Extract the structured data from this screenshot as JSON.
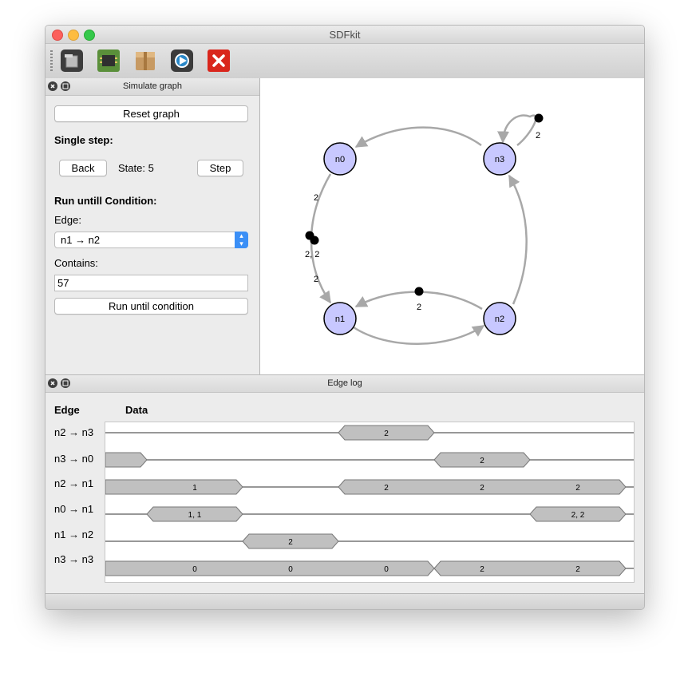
{
  "window": {
    "title": "SDFkit"
  },
  "toolbar": {
    "buttons": [
      {
        "name": "open-icon"
      },
      {
        "name": "chip-icon"
      },
      {
        "name": "package-icon"
      },
      {
        "name": "simulate-icon"
      },
      {
        "name": "close-red-icon"
      }
    ]
  },
  "simulate_pane": {
    "title": "Simulate graph",
    "reset_label": "Reset graph",
    "single_step_label": "Single step:",
    "back_label": "Back",
    "state_text": "State: 5",
    "step_label": "Step",
    "run_until_label": "Run untill Condition:",
    "edge_label": "Edge:",
    "edge_selected": "n1 → n2",
    "contains_label": "Contains:",
    "contains_value": "57",
    "run_button_label": "Run until condition"
  },
  "graph": {
    "nodes": [
      "n0",
      "n1",
      "n2",
      "n3"
    ],
    "edge_labels": {
      "n3_self": "2",
      "n0_upper": "2",
      "n0_middle": "2, 2",
      "n0_lower": "2",
      "n1_n2": "2"
    },
    "node_color": "#c8c8ff"
  },
  "edge_log": {
    "title": "Edge log",
    "col_edge": "Edge",
    "col_data": "Data",
    "rows": [
      {
        "edge": "n2 → n3",
        "tokens": [
          "2"
        ]
      },
      {
        "edge": "n3 → n0",
        "tokens": [
          "2"
        ]
      },
      {
        "edge": "n2 → n1",
        "tokens": [
          "1",
          "2",
          "2",
          "2"
        ]
      },
      {
        "edge": "n0 → n1",
        "tokens": [
          "1, 1",
          "2, 2"
        ]
      },
      {
        "edge": "n1 → n2",
        "tokens": [
          "2"
        ]
      },
      {
        "edge": "n3 → n3",
        "tokens": [
          "0",
          "0",
          "0",
          "2",
          "2"
        ]
      }
    ]
  }
}
